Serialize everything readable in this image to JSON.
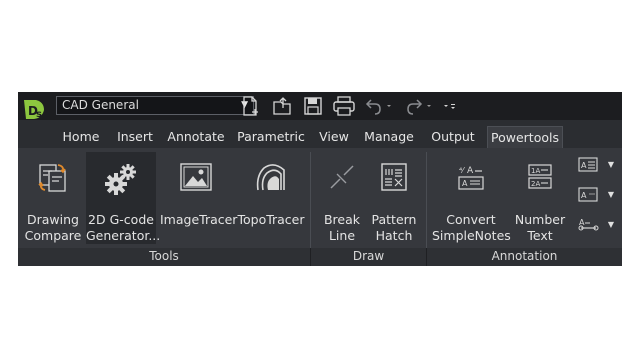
{
  "workspace": {
    "selected": "CAD General"
  },
  "quick_access": {
    "icons": [
      "new-file-icon",
      "open-file-icon",
      "save-icon",
      "print-icon",
      "undo-icon",
      "redo-icon",
      "customize-icon"
    ]
  },
  "tabs": [
    {
      "label": "Home",
      "active": false
    },
    {
      "label": "Insert",
      "active": false
    },
    {
      "label": "Annotate",
      "active": false
    },
    {
      "label": "Parametric",
      "active": false
    },
    {
      "label": "View",
      "active": false
    },
    {
      "label": "Manage",
      "active": false
    },
    {
      "label": "Output",
      "active": false
    },
    {
      "label": "Powertools",
      "active": true
    }
  ],
  "groups": {
    "tools": {
      "label": "Tools",
      "items": [
        {
          "line1": "Drawing",
          "line2": "Compare",
          "icon": "drawing-compare-icon"
        },
        {
          "line1": "2D G-code",
          "line2": "Generator...",
          "icon": "gears-icon"
        },
        {
          "line1": "ImageTracer",
          "line2": "",
          "icon": "image-icon"
        },
        {
          "line1": "TopoTracer",
          "line2": "",
          "icon": "topography-icon"
        }
      ]
    },
    "draw": {
      "label": "Draw",
      "items": [
        {
          "line1": "Break",
          "line2": "Line",
          "icon": "break-line-icon"
        },
        {
          "line1": "Pattern",
          "line2": "Hatch",
          "icon": "pattern-hatch-icon"
        }
      ]
    },
    "annotation": {
      "label": "Annotation",
      "items": [
        {
          "line1": "Convert",
          "line2": "SimpleNotes",
          "icon": "convert-notes-icon"
        },
        {
          "line1": "Number",
          "line2": "Text",
          "icon": "number-text-icon"
        }
      ],
      "small_tools": [
        "text-align-icon",
        "text-field-icon",
        "leader-icon"
      ]
    }
  },
  "colors": {
    "background": "#2b2d31",
    "ribbon": "#36383d",
    "accent_orange": "#e08a2c",
    "logo_green": "#8cc63f"
  }
}
